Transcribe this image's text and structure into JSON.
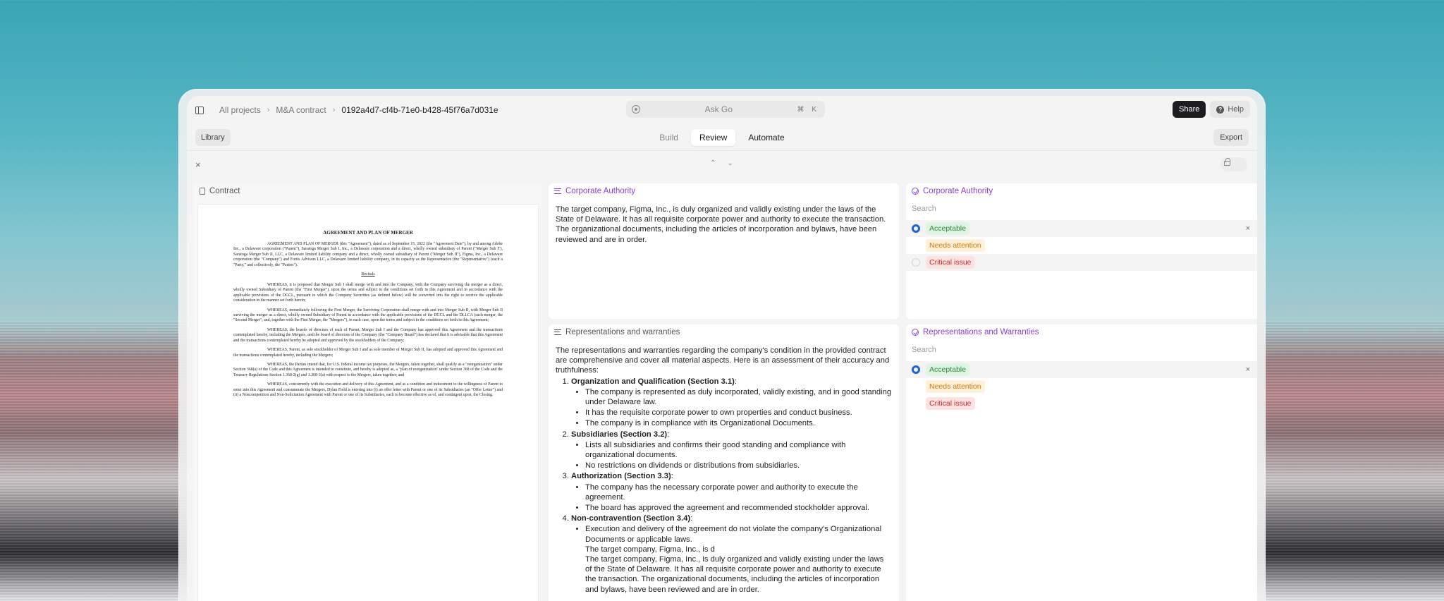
{
  "breadcrumb": {
    "root": "All projects",
    "project": "M&A contract",
    "current": "0192a4d7-cf4b-71e0-b428-45f76a7d031e"
  },
  "search_bar": {
    "label": "Ask Go",
    "shortcut": "⌘ K"
  },
  "header_actions": {
    "share": "Share",
    "help": "Help"
  },
  "modebar": {
    "library": "Library",
    "tabs": [
      {
        "label": "Build"
      },
      {
        "label": "Review"
      },
      {
        "label": "Automate"
      }
    ],
    "export": "Export"
  },
  "toolbar": {
    "close": "×",
    "up": "⌃",
    "down": "⌄"
  },
  "contract": {
    "title": "Contract",
    "doc_heading": "AGREEMENT AND PLAN OF MERGER",
    "doc_intro": "AGREEMENT AND PLAN OF MERGER (this \"Agreement\"), dated as of September 15, 2022 (the \"Agreement Date\"), by and among Adobe Inc., a Delaware corporation (\"Parent\"), Saratoga Merger Sub I, Inc., a Delaware corporation and a direct, wholly owned subsidiary of Parent (\"Merger Sub I\"), Saratoga Merger Sub II, LLC, a Delaware limited liability company and a direct, wholly owned subsidiary of Parent (\"Merger Sub II\"), Figma, Inc., a Delaware corporation (the \"Company\") and Fortis Advisors LLC, a Delaware limited liability company, in its capacity as the Representative (the \"Representative\") (each a \"Party,\" and collectively, the \"Parties\").",
    "doc_recitals": "Recitals",
    "doc_paras": [
      "WHEREAS, it is proposed that Merger Sub I shall merge with and into the Company, with the Company surviving the merger as a direct, wholly owned Subsidiary of Parent (the \"First Merger\"), upon the terms and subject to the conditions set forth in this Agreement and in accordance with the applicable provisions of the DGCL, pursuant to which the Company Securities (as defined below) will be converted into the right to receive the applicable consideration in the manner set forth herein;",
      "WHEREAS, immediately following the First Merger, the Surviving Corporation shall merge with and into Merger Sub II, with Merger Sub II surviving the merger as a direct, wholly owned Subsidiary of Parent in accordance with the applicable provisions of the DGCL and the DLLCA (such merger, the \"Second Merger\", and, together with the First Merger, the \"Mergers\"), in each case, upon the terms and subject to the conditions set forth in this Agreement;",
      "WHEREAS, the boards of directors of each of Parent, Merger Sub I and the Company has approved this Agreement and the transactions contemplated hereby, including the Mergers, and the board of directors of the Company (the \"Company Board\") has declared that it is advisable that this Agreement and the transactions contemplated hereby be adopted and approved by the stockholders of the Company;",
      "WHEREAS, Parent, as sole stockholder of Merger Sub I and as sole member of Merger Sub II, has adopted and approved this Agreement and the transactions contemplated hereby, including the Mergers;",
      "WHEREAS, the Parties intend that, for U.S. federal income tax purposes, the Mergers, taken together, shall qualify as a \"reorganization\" under Section 368(a) of the Code and this Agreement is intended to constitute, and hereby is adopted as, a \"plan of reorganization\" under Section 368 of the Code and the Treasury Regulations Section 1.368-2(g) and 1.368-3(a) with respect to the Mergers, taken together; and",
      "WHEREAS, concurrently with the execution and delivery of this Agreement, and as a condition and inducement to the willingness of Parent to enter into this Agreement and consummate the Mergers, Dylan Field is entering into (i) an offer letter with Parent or one of its Subsidiaries (an \"Offer Letter\") and (ii) a Noncompetition and Non-Solicitation Agreement with Parent or one of its Subsidiaries, each to become effective as of, and contingent upon, the Closing."
    ]
  },
  "corporate_authority": {
    "title": "Corporate Authority",
    "text": "The target company, Figma, Inc., is duly organized and validly existing under the laws of the State of Delaware. It has all requisite corporate power and authority to execute the transaction. The organizational documents, including the articles of incorporation and bylaws, have been reviewed and are in order."
  },
  "reps_warranties": {
    "title": "Representations and warranties",
    "intro": "The representations and warranties regarding the company's condition in the provided contract are comprehensive and cover all material aspects. Here is an assessment of their accuracy and truthfulness:",
    "sections": [
      {
        "heading": "Organization and Qualification (Section 3.1)",
        "bullets": [
          "The company is represented as duly incorporated, validly existing, and in good standing under Delaware law.",
          "It has the requisite corporate power to own properties and conduct business.",
          "The company is in compliance with its Organizational Documents."
        ]
      },
      {
        "heading": "Subsidiaries (Section 3.2)",
        "bullets": [
          "Lists all subsidiaries and confirms their good standing and compliance with organizational documents.",
          "No restrictions on dividends or distributions from subsidiaries."
        ]
      },
      {
        "heading": "Authorization (Section 3.3)",
        "bullets": [
          "The company has the necessary corporate power and authority to execute the agreement.",
          "The board has approved the agreement and recommended stockholder approval."
        ]
      },
      {
        "heading": "Non-contravention (Section 3.4)",
        "bullets": [
          "Execution and delivery of the agreement do not violate the company's Organizational Documents or applicable laws.",
          "The target company, Figma, Inc., is d",
          "The target company, Figma, Inc., is duly organized and validly existing under the laws of the State of Delaware. It has all requisite corporate power and authority to execute the transaction. The organizational documents, including the articles of incorporation and bylaws, have been reviewed and are in order."
        ]
      }
    ]
  },
  "review_ca": {
    "title": "Corporate Authority",
    "search_placeholder": "Search",
    "options": [
      {
        "label": "Acceptable",
        "state": "selected"
      },
      {
        "label": "Needs attention",
        "state": "none"
      },
      {
        "label": "Critical issue",
        "state": "empty"
      }
    ],
    "clear": "×"
  },
  "review_rw": {
    "title": "Representations and Warranties",
    "search_placeholder": "Search",
    "options": [
      {
        "label": "Acceptable",
        "state": "selected"
      },
      {
        "label": "Needs attention",
        "state": "none"
      },
      {
        "label": "Critical issue",
        "state": "none"
      }
    ],
    "clear": "×"
  },
  "colors": {
    "accent_purple": "#8a3fd1",
    "radio_blue": "#1c63d8",
    "acceptable": "#2b8a3e",
    "attention": "#d97706",
    "critical": "#c92a2a"
  }
}
